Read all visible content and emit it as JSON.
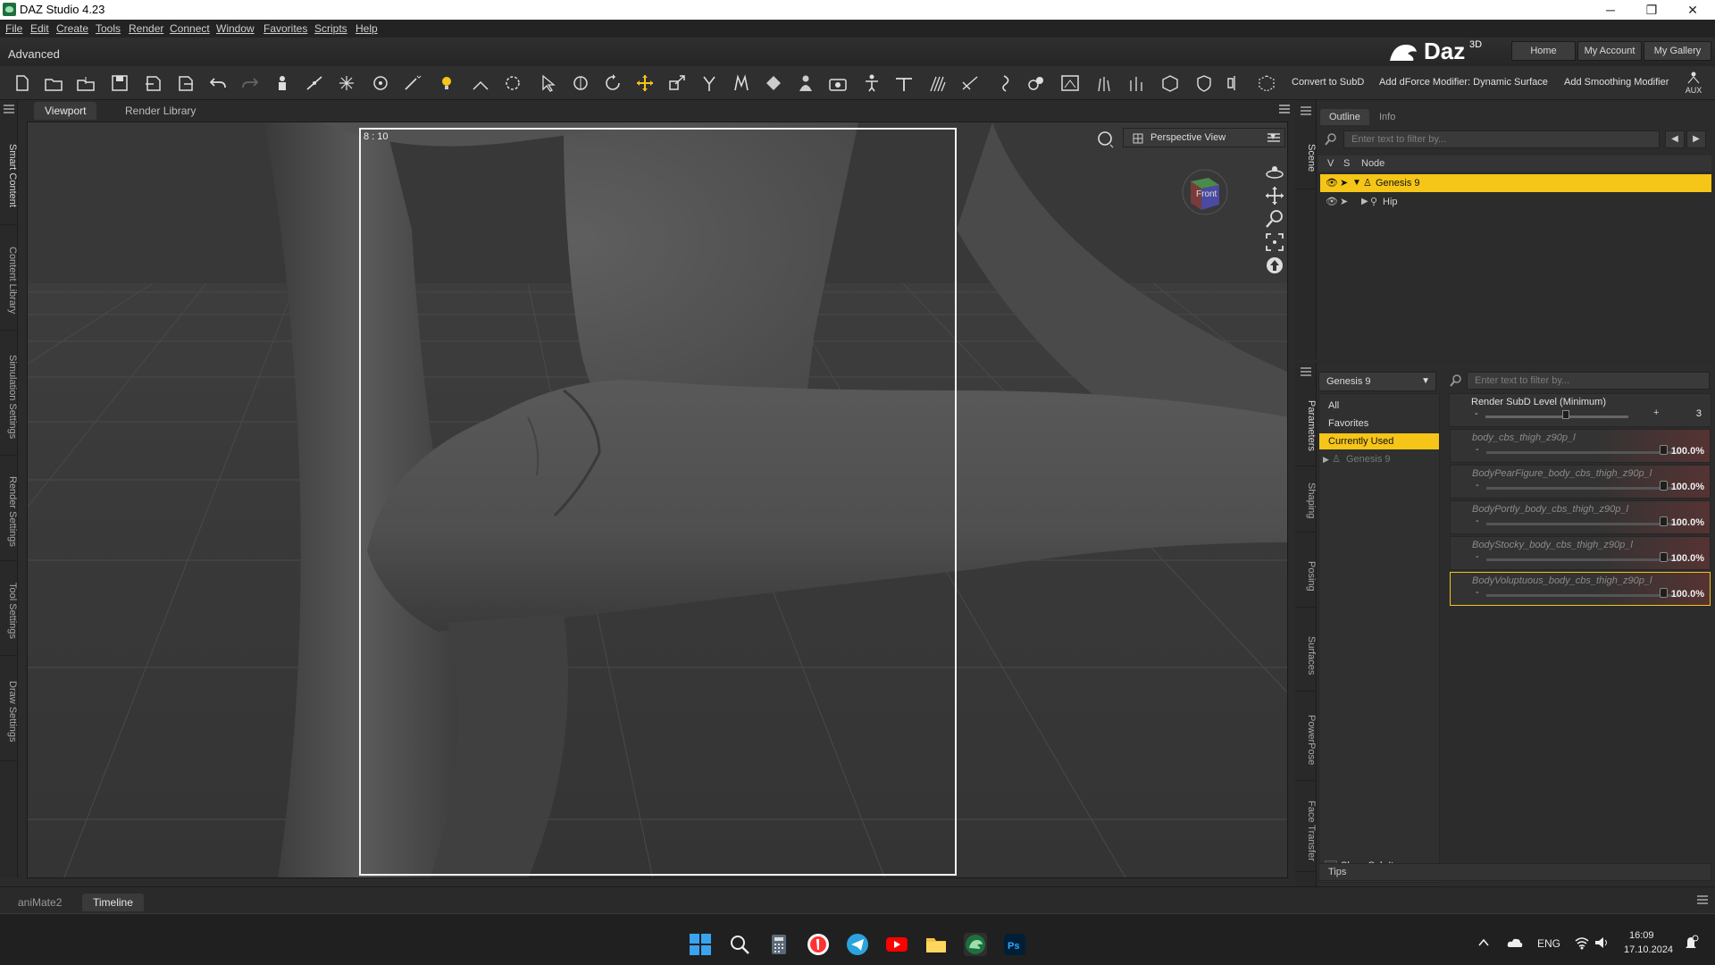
{
  "window": {
    "title": "DAZ Studio 4.23",
    "minimize": "─",
    "maximize": "❐",
    "close": "✕"
  },
  "menu": [
    "File",
    "Edit",
    "Create",
    "Tools",
    "Render",
    "Connect",
    "Window",
    "Favorites",
    "Scripts",
    "Help"
  ],
  "header": {
    "layout": "Advanced",
    "logo": "Daz",
    "logo_sup": "3D",
    "buttons": [
      "Home",
      "My Account",
      "My Gallery"
    ]
  },
  "toolbar": {
    "text_buttons": [
      "Convert to SubD",
      "Add dForce Modifier: Dynamic Surface",
      "Add Smoothing Modifier"
    ],
    "aux": "AUX"
  },
  "left_tabs": [
    "Smart Content",
    "Content Library",
    "Simulation Settings",
    "Render Settings",
    "Tool Settings",
    "Draw Settings"
  ],
  "viewport": {
    "tabs": [
      "Viewport",
      "Render Library"
    ],
    "aspect": "8 : 10",
    "view_select": "Perspective View",
    "cube_label": "Front"
  },
  "scene": {
    "side_tab": "Scene",
    "tabs": [
      "Outline",
      "Info"
    ],
    "filter_placeholder": "Enter text to filter by...",
    "columns": [
      "V",
      "S",
      "Node"
    ],
    "nodes": [
      "Genesis 9",
      "Hip"
    ]
  },
  "params": {
    "side_tabs": [
      "Parameters",
      "Shaping",
      "Posing",
      "Surfaces",
      "PowerPose",
      "Face Transfer"
    ],
    "node_select": "Genesis 9",
    "categories": [
      "All",
      "Favorites",
      "Currently Used"
    ],
    "tree_node": "Genesis 9",
    "filter_placeholder": "Enter text to filter by...",
    "subd": {
      "label": "Render SubD Level (Minimum)",
      "value": "3"
    },
    "sliders": [
      {
        "label": "body_cbs_thigh_z90p_l",
        "value": "100.0%"
      },
      {
        "label": "BodyPearFigure_body_cbs_thigh_z90p_l",
        "value": "100.0%"
      },
      {
        "label": "BodyPortly_body_cbs_thigh_z90p_l",
        "value": "100.0%"
      },
      {
        "label": "BodyStocky_body_cbs_thigh_z90p_l",
        "value": "100.0%"
      },
      {
        "label": "BodyVoluptuous_body_cbs_thigh_z90p_l",
        "value": "100.0%"
      }
    ],
    "show_sub_items": "Show Sub Items",
    "tips": "Tips"
  },
  "bottom_tabs": [
    "aniMate2",
    "Timeline"
  ],
  "taskbar": {
    "lang": "ENG",
    "time": "16:09",
    "date": "17.10.2024"
  },
  "colors": {
    "accent": "#f5c518",
    "bg": "#2b2b2b"
  }
}
